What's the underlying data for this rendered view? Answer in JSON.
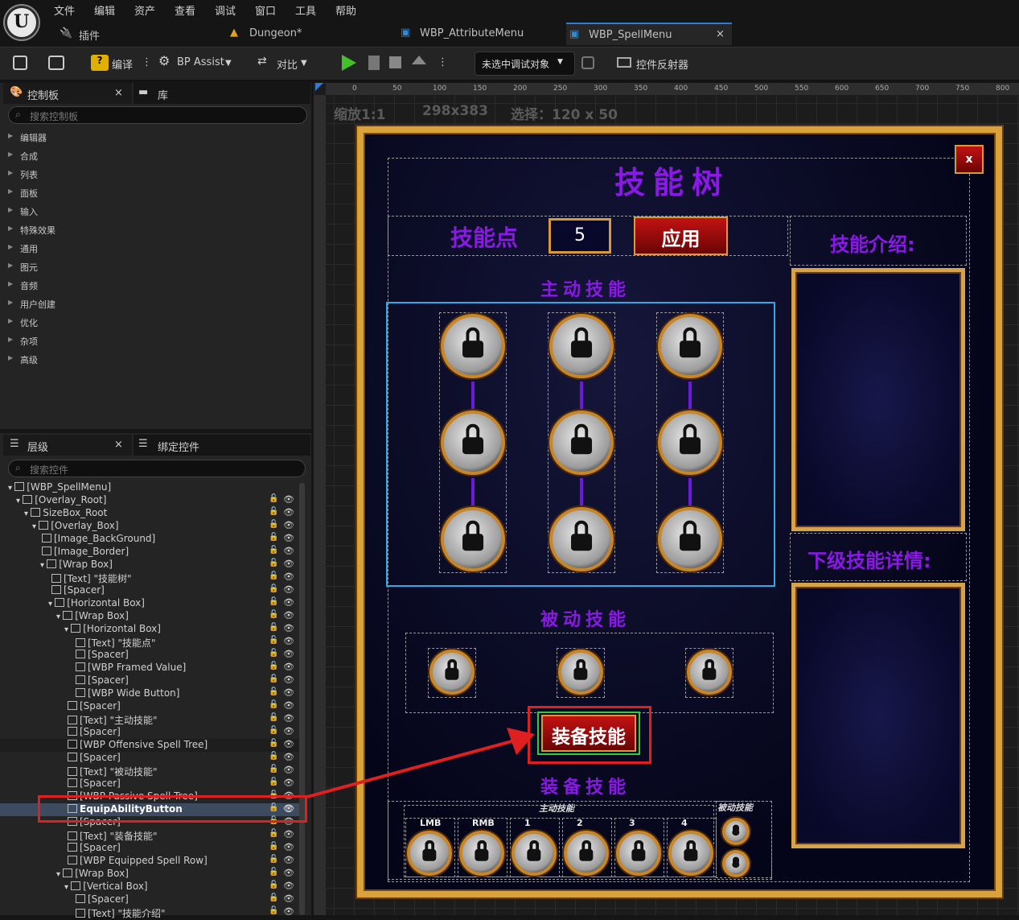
{
  "menu": [
    "文件",
    "编辑",
    "资产",
    "查看",
    "调试",
    "窗口",
    "工具",
    "帮助"
  ],
  "tabs": [
    {
      "label": "插件"
    },
    {
      "label": "Dungeon*"
    },
    {
      "label": "WBP_AttributeMenu"
    },
    {
      "label": "WBP_SpellMenu"
    }
  ],
  "tab_close": "×",
  "toolbar": {
    "compile": "编译",
    "bp_assist": "BP Assist",
    "diff": "对比",
    "debug_target": "未选中调试对象",
    "reflector": "控件反射器"
  },
  "palette": {
    "title": "控制板",
    "lib_tab": "库",
    "search_placeholder": "搜索控制板",
    "categories": [
      "编辑器",
      "合成",
      "列表",
      "面板",
      "输入",
      "特殊效果",
      "通用",
      "图元",
      "音频",
      "用户创建",
      "优化",
      "杂项",
      "高级"
    ]
  },
  "hierarchy": {
    "title": "层级",
    "bind_tab": "绑定控件",
    "search_placeholder": "搜索控件",
    "rows": [
      "[WBP_SpellMenu]",
      "[Overlay_Root]",
      "SizeBox_Root",
      "[Overlay_Box]",
      "[Image_BackGround]",
      "[Image_Border]",
      "[Wrap Box]",
      "[Text] \"技能树\"",
      "[Spacer]",
      "[Horizontal Box]",
      "[Wrap Box]",
      "[Horizontal Box]",
      "[Text] \"技能点\"",
      "[Spacer]",
      "[WBP Framed Value]",
      "[Spacer]",
      "[WBP Wide Button]",
      "[Spacer]",
      "[Text] \"主动技能\"",
      "[Spacer]",
      "[WBP Offensive Spell Tree]",
      "[Spacer]",
      "[Text] \"被动技能\"",
      "[Spacer]",
      "[WBP Passive Spell Tree]",
      "EquipAbilityButton",
      "[Spacer]",
      "[Text] \"装备技能\"",
      "[Spacer]",
      "[WBP Equipped Spell Row]",
      "[Wrap Box]",
      "[Vertical Box]",
      "[Spacer]",
      "[Text] \"技能介绍\""
    ]
  },
  "designer": {
    "zoom": "缩放1:1",
    "size": "298x383",
    "selection": "选择：120 x 50",
    "ruler": [
      "0",
      "50",
      "100",
      "150",
      "200",
      "250",
      "300",
      "350",
      "400",
      "450",
      "500",
      "550",
      "600",
      "650",
      "700",
      "750",
      "800"
    ]
  },
  "widget": {
    "title": "技能树",
    "points_label": "技能点",
    "points_value": "5",
    "apply": "应用",
    "close": "x",
    "offensive": "主动技能",
    "passive": "被动技能",
    "equip_button": "装备技能",
    "equipped": "装备技能",
    "desc_title": "技能介绍:",
    "next_title": "下级技能详情:",
    "row_active": "主动技能",
    "row_passive": "被动技能",
    "slots": [
      "LMB",
      "RMB",
      "1",
      "2",
      "3",
      "4"
    ]
  }
}
